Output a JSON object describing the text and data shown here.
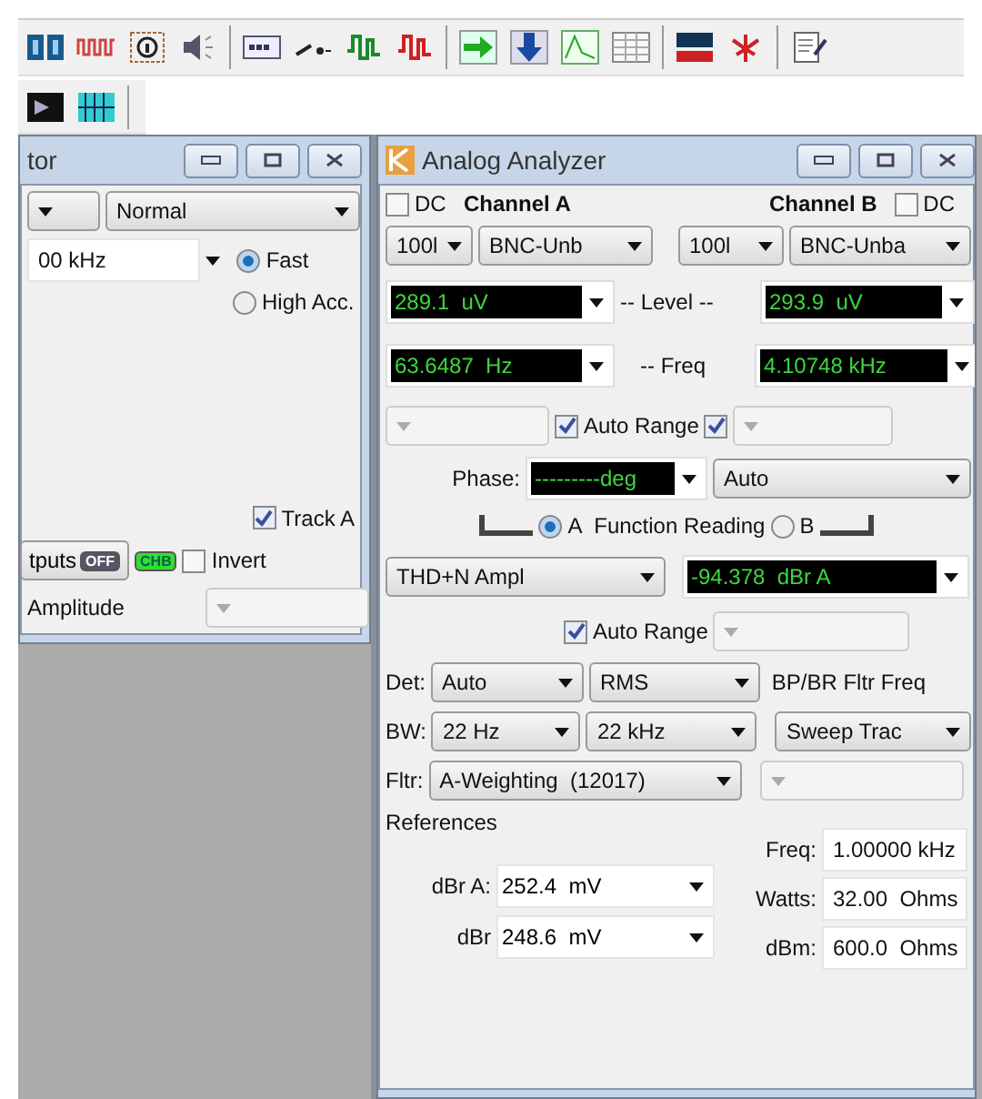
{
  "left_window": {
    "title": "tor",
    "mode": "Normal",
    "frequency": "00 kHz",
    "speed_options": [
      {
        "label": "Fast",
        "selected": true
      },
      {
        "label": "High Acc.",
        "selected": false
      }
    ],
    "track_a": {
      "label": "Track A",
      "checked": true
    },
    "outputs_button": {
      "label": "tputs",
      "badge": "OFF"
    },
    "channel_badge": "CHB",
    "invert": {
      "label": "Invert",
      "checked": false
    },
    "amplitude": {
      "label": "Amplitude",
      "disabled": true
    }
  },
  "analyzer": {
    "title": "Analog Analyzer",
    "channels": [
      {
        "dc": {
          "label": "DC",
          "checked": false
        },
        "name": "Channel A",
        "range": "100l",
        "input": "BNC-Unb",
        "level": "289.1  uV",
        "freq": "63.6487  Hz",
        "auto_range": {
          "label": "Auto Range",
          "checked": true
        }
      },
      {
        "dc": {
          "label": "DC",
          "checked": false
        },
        "name": "Channel B",
        "range": "100l",
        "input": "BNC-Unba",
        "level": "293.9  uV",
        "freq": "4.10748 kHz",
        "auto_range": {
          "checked": true
        }
      }
    ],
    "level_label": "-- Level --",
    "freq_label": "-- Freq",
    "phase": {
      "label": "Phase:",
      "reading": "---------deg",
      "mode": "Auto"
    },
    "function_reading": {
      "label": "Function Reading",
      "channels": [
        {
          "label": "A",
          "selected": true
        },
        {
          "label": "B",
          "selected": false
        }
      ],
      "function": "THD+N Ampl",
      "reading": "-94.378  dBr A",
      "auto_range": {
        "label": "Auto Range",
        "checked": true
      }
    },
    "detector": {
      "label": "Det:",
      "values": [
        "Auto",
        "RMS"
      ]
    },
    "bp_br_label": "BP/BR Fltr Freq",
    "bandwidth": {
      "label": "BW:",
      "values": [
        "22 Hz",
        "22 kHz"
      ],
      "sweep": "Sweep Trac"
    },
    "filter": {
      "label": "Fltr:",
      "value": "A-Weighting  (12017)"
    },
    "references": {
      "title": "References",
      "left": [
        {
          "label": "dBr A:",
          "value": "252.4  mV"
        },
        {
          "label": "dBr",
          "value": "248.6  mV"
        }
      ],
      "right": [
        {
          "label": "Freq:",
          "value": "1.00000 kHz"
        },
        {
          "label": "Watts:",
          "value": "32.00  Ohms"
        },
        {
          "label": "dBm:",
          "value": "600.0  Ohms"
        }
      ]
    }
  }
}
